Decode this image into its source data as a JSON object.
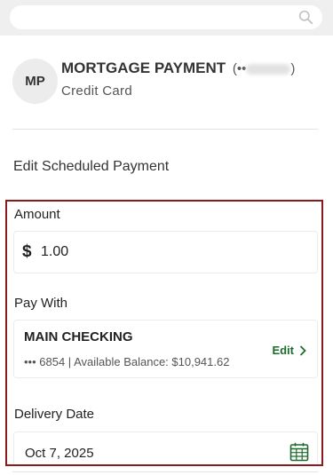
{
  "search": {
    "placeholder": "",
    "icon": "search-icon"
  },
  "payee": {
    "initials": "MP",
    "name": "MORTGAGE PAYMENT",
    "mask_prefix": "(••",
    "mask_suffix": ")",
    "type": "Credit Card"
  },
  "section_title": "Edit Scheduled Payment",
  "amount": {
    "label": "Amount",
    "currency": "$",
    "value": "1.00"
  },
  "pay_with": {
    "label": "Pay With",
    "account_name": "MAIN CHECKING",
    "account_detail": "••• 6854 | Available Balance: $10,941.62",
    "edit_label": "Edit"
  },
  "delivery": {
    "label": "Delivery Date",
    "date": "Oct 7, 2025",
    "icon": "calendar-icon"
  },
  "colors": {
    "accent_green": "#1d6b2c",
    "highlight_border": "#8b1a1a"
  }
}
